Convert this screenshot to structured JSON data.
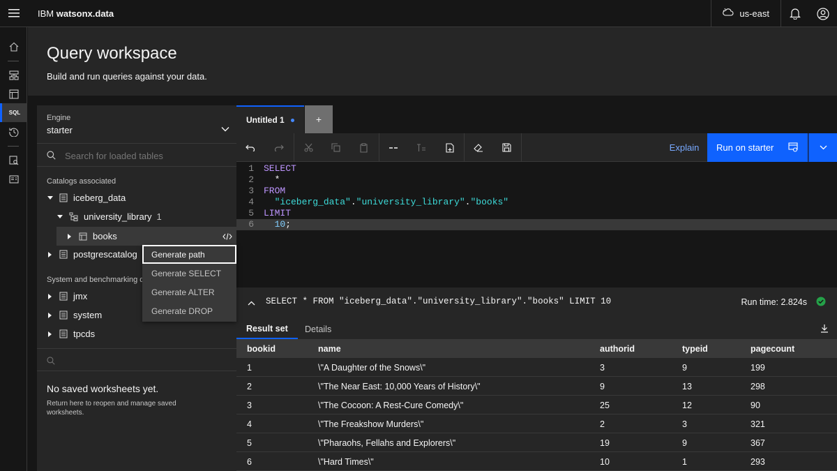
{
  "header": {
    "brand_prefix": "IBM",
    "brand_name": "watsonx.data",
    "region": "us-east"
  },
  "rail": {
    "sql_label": "SQL"
  },
  "page": {
    "title": "Query workspace",
    "subtitle": "Build and run queries against your data."
  },
  "left_panel": {
    "engine_label": "Engine",
    "engine_value": "starter",
    "search_placeholder": "Search for loaded tables",
    "catalogs_label": "Catalogs associated",
    "catalog_iceberg": "iceberg_data",
    "schema_name": "university_library",
    "schema_count": "1",
    "table_name": "books",
    "catalog_postgres": "postgrescatalog",
    "system_label": "System and benchmarking da",
    "system_catalogs": [
      "jmx",
      "system",
      "tpcds"
    ],
    "no_worksheets_title": "No saved worksheets yet.",
    "no_worksheets_sub": "Return here to reopen and manage saved worksheets."
  },
  "context_menu": {
    "items": [
      "Generate path",
      "Generate SELECT",
      "Generate ALTER",
      "Generate DROP"
    ]
  },
  "editor": {
    "tab_label": "Untitled 1",
    "add_tab": "+",
    "explain_label": "Explain",
    "run_label": "Run on starter",
    "line_numbers": [
      "1",
      "2",
      "3",
      "4",
      "5",
      "6"
    ],
    "lines": {
      "l1": "SELECT",
      "l2": "  *",
      "l3": "FROM",
      "l4_a": "  \"iceberg_data\"",
      "l4_b": ".",
      "l4_c": "\"university_library\"",
      "l4_d": ".",
      "l4_e": "\"books\"",
      "l5": "LIMIT",
      "l6_a": "  10",
      "l6_b": ";"
    }
  },
  "results": {
    "query": "SELECT * FROM \"iceberg_data\".\"university_library\".\"books\" LIMIT 10",
    "runtime": "Run time: 2.824s",
    "tab_result": "Result set",
    "tab_details": "Details",
    "columns": [
      "bookid",
      "name",
      "authorid",
      "typeid",
      "pagecount"
    ],
    "rows": [
      [
        "1",
        "\\\"A Daughter of the Snows\\\"",
        "3",
        "9",
        "199"
      ],
      [
        "2",
        "\\\"The Near East: 10,000 Years of History\\\"",
        "9",
        "13",
        "298"
      ],
      [
        "3",
        "\\\"The Cocoon: A Rest-Cure Comedy\\\"",
        "25",
        "12",
        "90"
      ],
      [
        "4",
        "\\\"The Freakshow Murders\\\"",
        "2",
        "3",
        "321"
      ],
      [
        "5",
        "\\\"Pharaohs, Fellahs and Explorers\\\"",
        "19",
        "9",
        "367"
      ],
      [
        "6",
        "\\\"Hard Times\\\"",
        "10",
        "1",
        "293"
      ]
    ]
  },
  "colors": {
    "accent": "#0f62fe",
    "keyword": "#be95ff",
    "string": "#3ddbd9",
    "number": "#82cfff",
    "success": "#24a148"
  }
}
